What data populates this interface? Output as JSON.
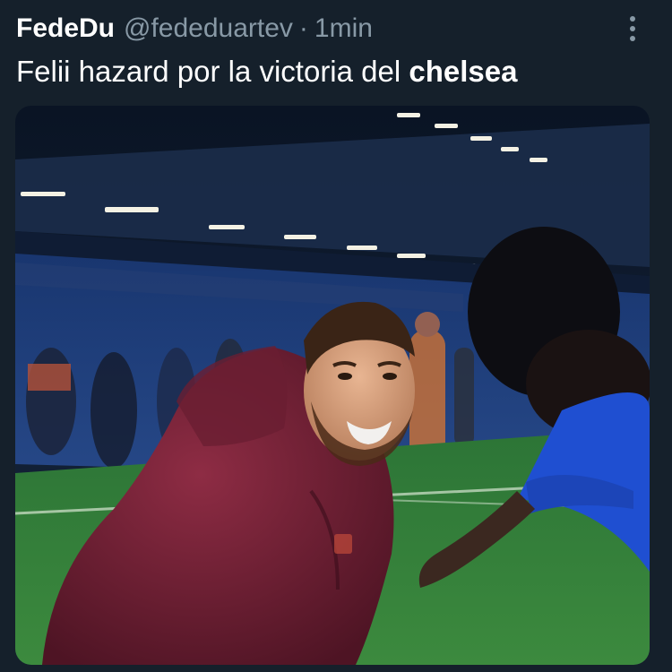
{
  "tweet": {
    "display_name": "FedeDu",
    "handle": "@fededuartev",
    "separator": "·",
    "time": "1min",
    "text_plain": "Felii hazard por la victoria del ",
    "text_bold": "chelsea",
    "more_icon": "more-vertical-icon"
  },
  "media": {
    "description_type": "photo",
    "accent_colors": {
      "background": "#15202b",
      "secondary_text": "#8899a6",
      "pitch": "#2f7a3a",
      "jacket": "#7a2638",
      "kit_blue": "#1f4fd1"
    }
  }
}
